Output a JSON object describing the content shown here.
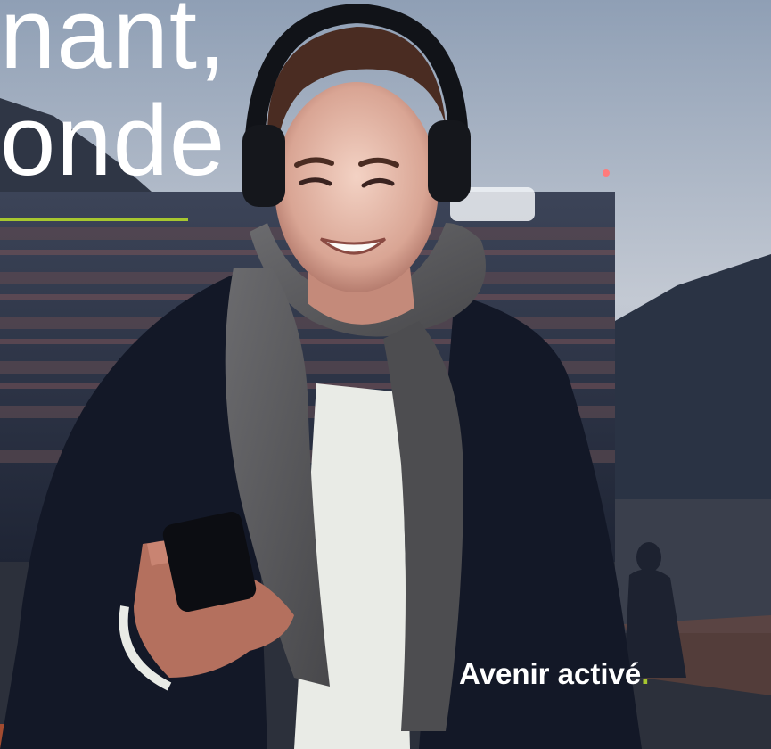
{
  "headline": {
    "line1": "nant,",
    "line2": "onde"
  },
  "tagline": {
    "text": "Avenir activé",
    "dot": "."
  },
  "colors": {
    "accent_green": "#a7c72f",
    "text_white": "#ffffff",
    "jacket_navy": "#151a2b",
    "scarf_gray": "#5a5a5c",
    "sky_gray": "#b6bdc8"
  }
}
